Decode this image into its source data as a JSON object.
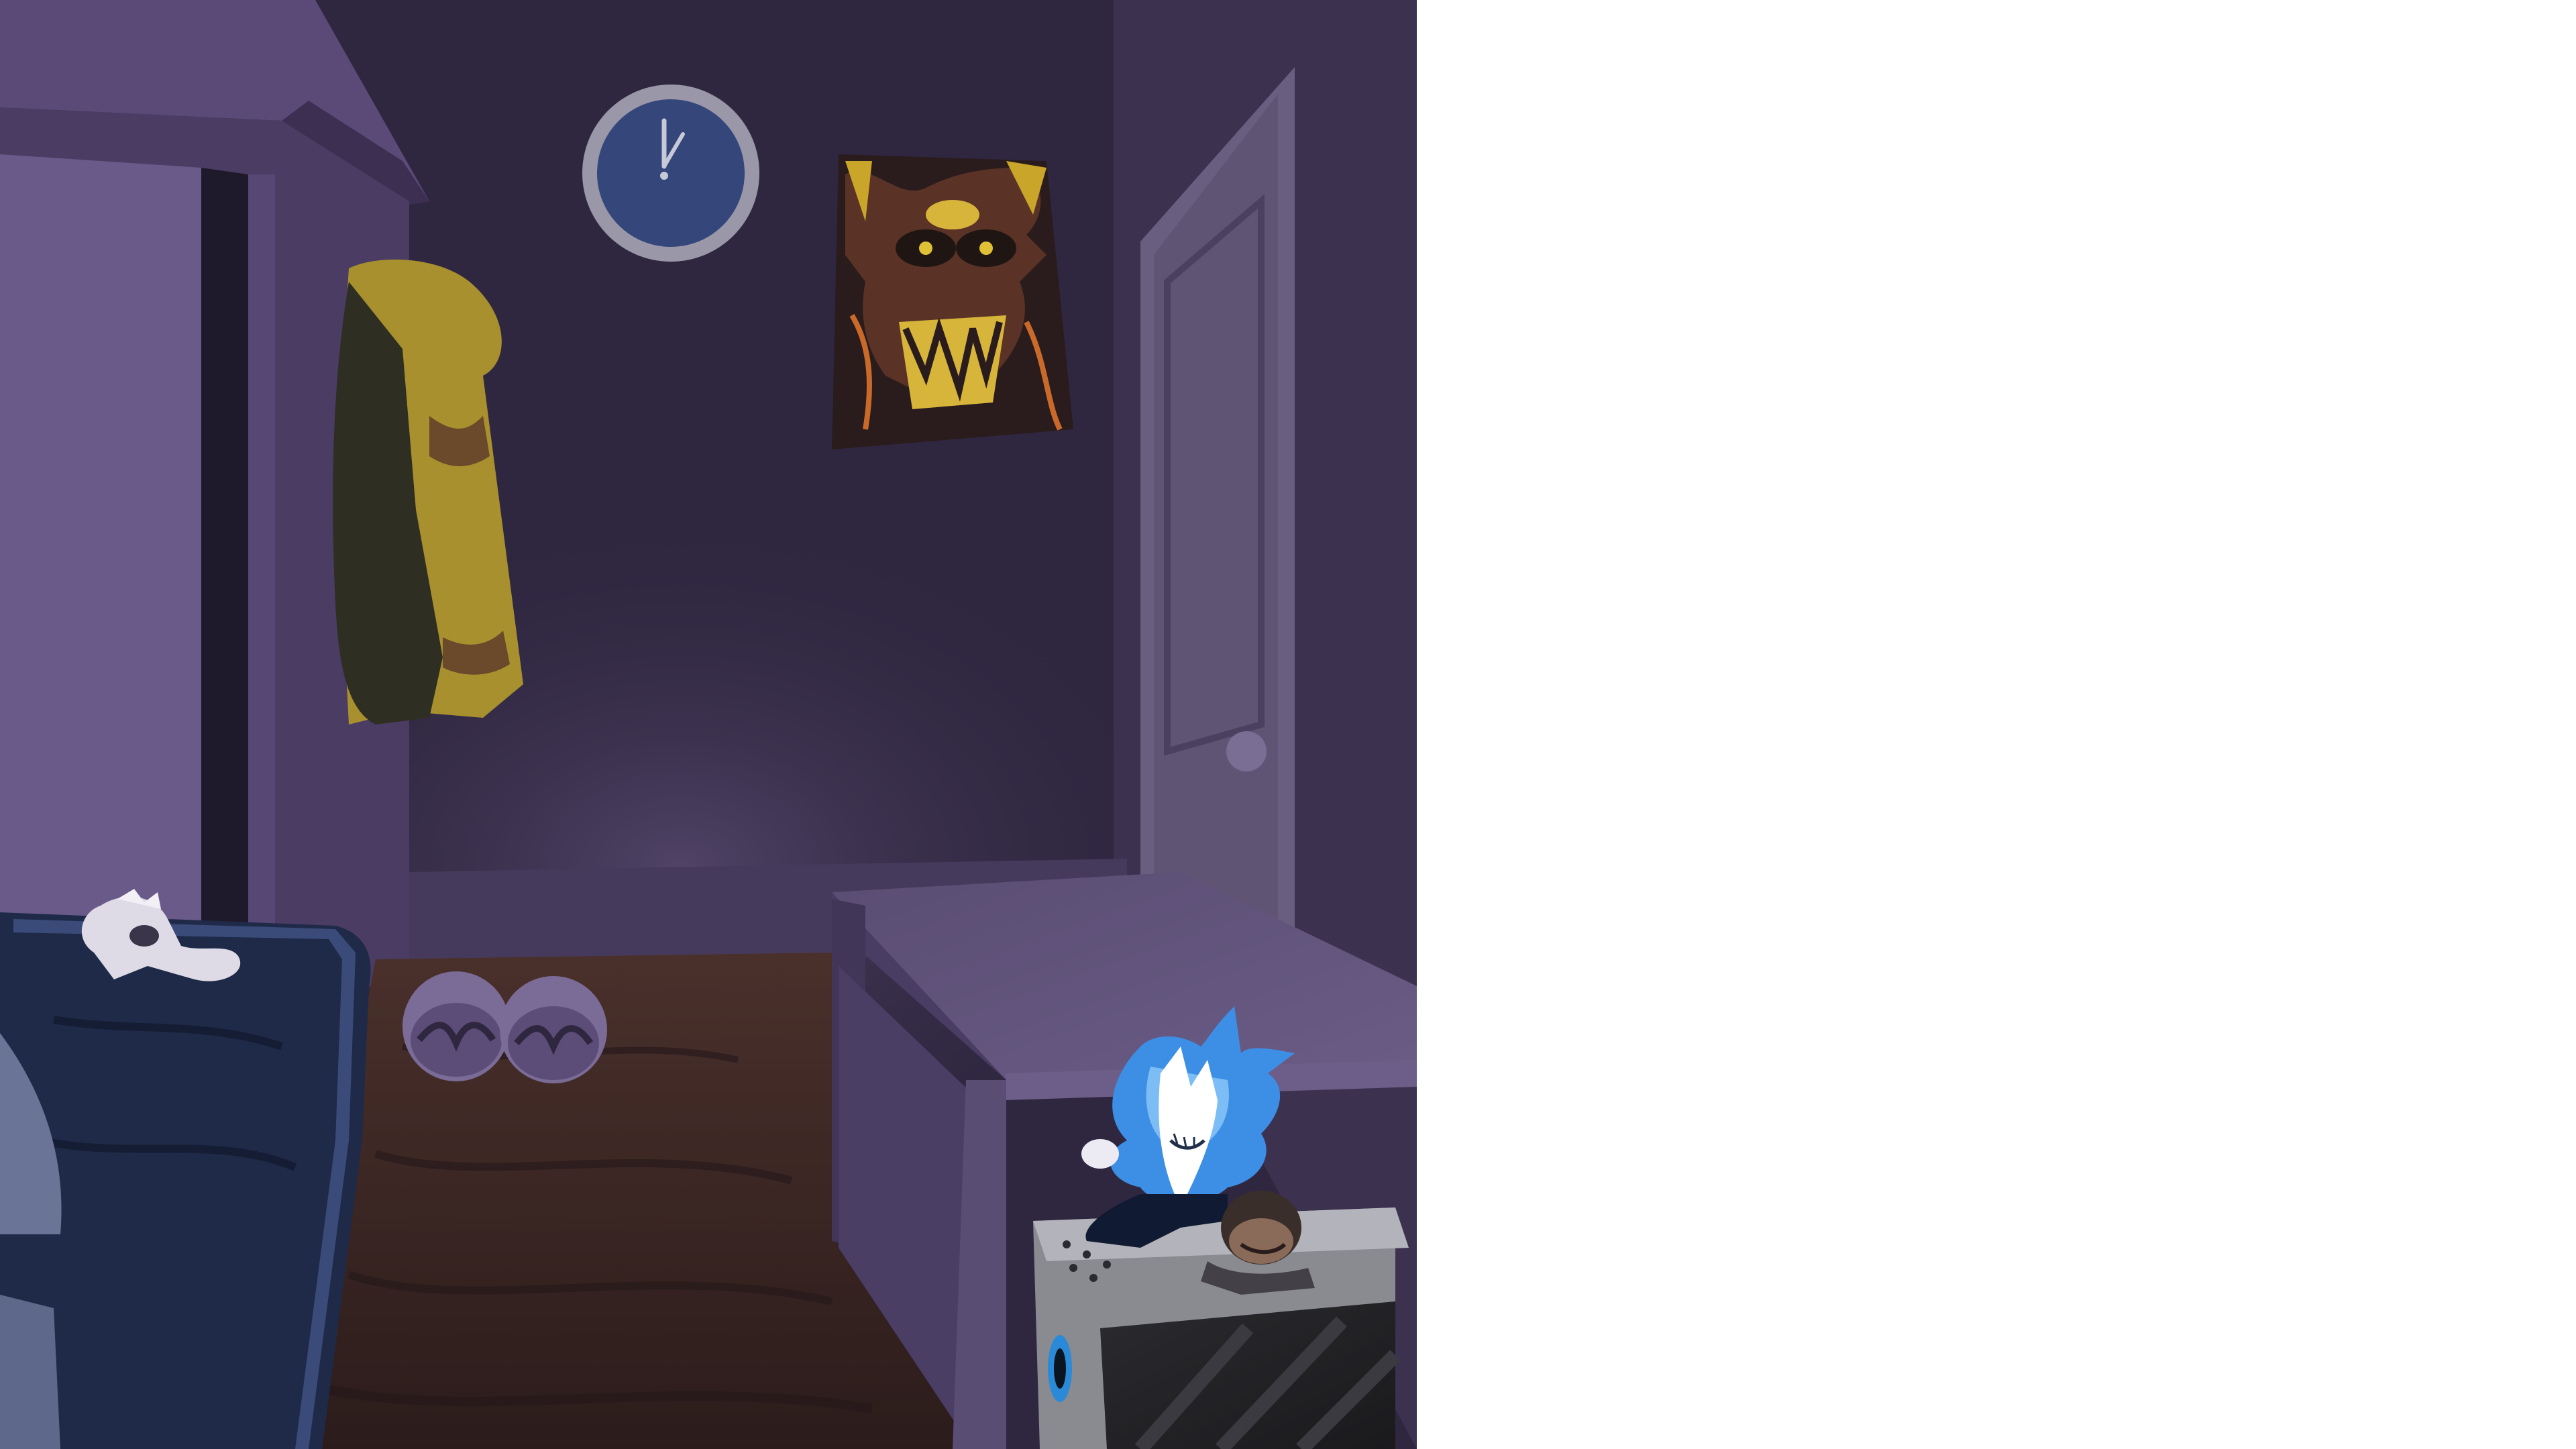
{
  "scene": {
    "room": "bedroom",
    "colors": {
      "back_wall": "#2f2740",
      "left_wall": "#4a3c63",
      "right_wall": "#3d3150",
      "floor": "#3a2623",
      "door": "#5f5474",
      "desk": "#5a4d73",
      "bed_blanket": "#1f2a48",
      "clock_face": "#34467a",
      "poster_accent": "#c9a52a",
      "spirit_glow": "#3d8fe6"
    },
    "icons": {
      "clock": "wall-clock-icon",
      "poster": "skull-poster-icon",
      "plush": "ghost-plush-icon",
      "slippers": "slippers-icon",
      "jacket": "jacket-icon"
    }
  }
}
